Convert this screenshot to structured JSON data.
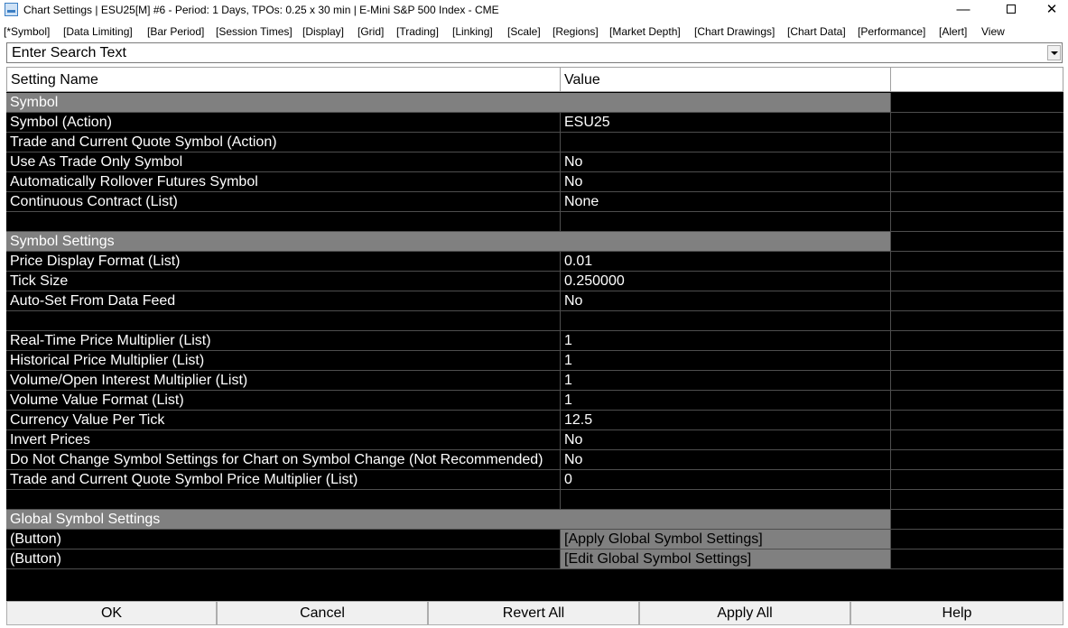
{
  "window": {
    "title": "Chart Settings | ESU25[M] #6 - Period: 1 Days, TPOs: 0.25 x 30 min   | E-Mini S&P 500 Index - CME",
    "minimize_glyph": "—",
    "close_glyph": "✕"
  },
  "menu": [
    "[*Symbol]",
    "[Data Limiting]",
    "[Bar Period]",
    "[Session Times]",
    "[Display]",
    "[Grid]",
    "[Trading]",
    "[Linking]",
    "[Scale]",
    "[Regions]",
    "[Market Depth]",
    "[Chart Drawings]",
    "[Chart Data]",
    "[Performance]",
    "[Alert]",
    "View"
  ],
  "search": {
    "placeholder": "Enter Search Text"
  },
  "grid": {
    "header": {
      "name": "Setting Name",
      "value": "Value"
    },
    "rows": [
      {
        "type": "section",
        "name": "Symbol"
      },
      {
        "type": "setting",
        "name": "Symbol (Action)",
        "value": "ESU25"
      },
      {
        "type": "setting",
        "name": "Trade and Current Quote Symbol (Action)",
        "value": ""
      },
      {
        "type": "setting",
        "name": "Use As Trade Only Symbol",
        "value": "No"
      },
      {
        "type": "setting",
        "name": "Automatically Rollover Futures Symbol",
        "value": "No"
      },
      {
        "type": "setting",
        "name": "Continuous Contract (List)",
        "value": "None"
      },
      {
        "type": "blank"
      },
      {
        "type": "section",
        "name": "Symbol Settings"
      },
      {
        "type": "setting",
        "name": "Price Display Format (List)",
        "value": "0.01"
      },
      {
        "type": "setting",
        "name": "Tick Size",
        "value": "0.250000"
      },
      {
        "type": "setting",
        "name": "Auto-Set From Data Feed",
        "value": "No"
      },
      {
        "type": "blank"
      },
      {
        "type": "setting",
        "name": "Real-Time Price Multiplier (List)",
        "value": "1"
      },
      {
        "type": "setting",
        "name": "Historical Price Multiplier (List)",
        "value": "1"
      },
      {
        "type": "setting",
        "name": "Volume/Open Interest Multiplier (List)",
        "value": "1"
      },
      {
        "type": "setting",
        "name": "Volume Value Format (List)",
        "value": "1"
      },
      {
        "type": "setting",
        "name": "Currency Value Per Tick",
        "value": "12.5"
      },
      {
        "type": "setting",
        "name": "Invert Prices",
        "value": "No"
      },
      {
        "type": "setting",
        "name": "Do Not Change Symbol Settings for Chart on Symbol Change (Not Recommended)",
        "value": "No"
      },
      {
        "type": "setting",
        "name": "Trade and Current Quote Symbol Price Multiplier (List)",
        "value": "0"
      },
      {
        "type": "blank"
      },
      {
        "type": "section",
        "name": "Global Symbol Settings"
      },
      {
        "type": "button",
        "name": " (Button)",
        "value": "[Apply Global Symbol Settings]"
      },
      {
        "type": "button",
        "name": " (Button)",
        "value": "[Edit Global Symbol Settings]"
      }
    ]
  },
  "buttons": {
    "ok": "OK",
    "cancel": "Cancel",
    "revert_all": "Revert All",
    "apply_all": "Apply All",
    "help": "Help"
  },
  "colors": {
    "grid_bg": "#000000",
    "section_bg": "#808080",
    "text": "#ffffff"
  }
}
